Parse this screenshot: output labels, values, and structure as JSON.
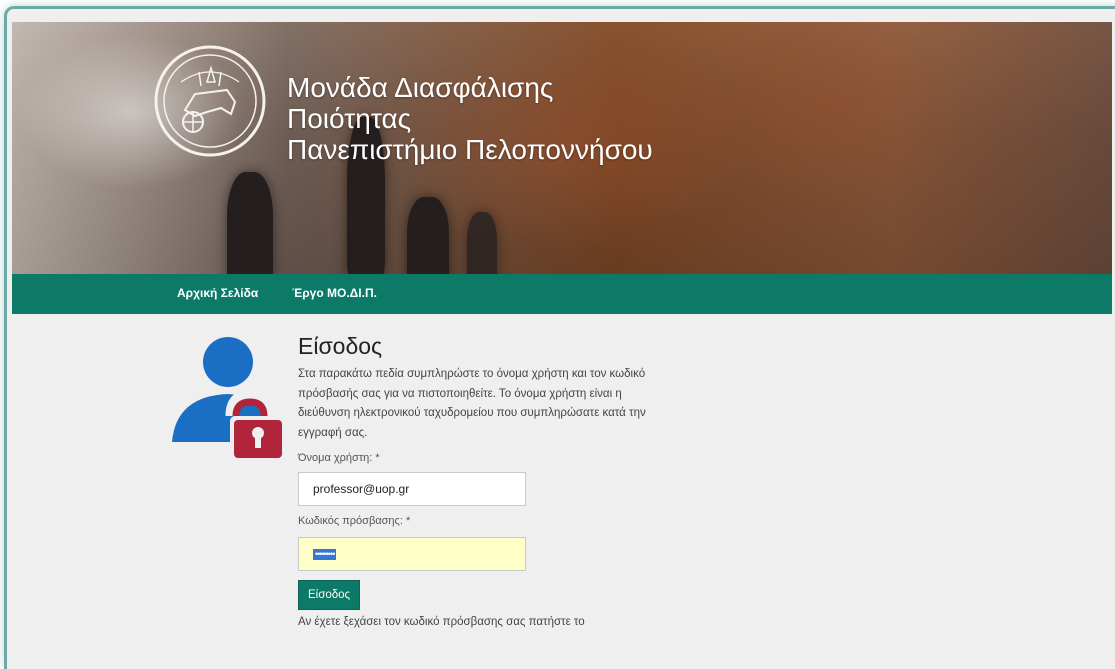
{
  "header": {
    "title_lines": [
      "Μονάδα Διασφάλισης",
      "Ποιότητας",
      "Πανεπιστήμιο Πελοποννήσου"
    ]
  },
  "nav": {
    "items": [
      {
        "label": "Αρχική Σελίδα"
      },
      {
        "label": "Έργο ΜΟ.ΔΙ.Π."
      }
    ]
  },
  "login": {
    "heading": "Είσοδος",
    "intro": "Στα παρακάτω πεδία συμπληρώστε το όνομα χρήστη και τον κωδικό πρόσβασής σας για να πιστοποιηθείτε. Το όνομα χρήστη είναι η διεύθυνση ηλεκτρονικού ταχυδρομείου που συμπληρώσατε κατά την εγγραφή σας.",
    "username_label": "Όνομα χρήστη: *",
    "username_value": "professor@uop.gr",
    "password_label": "Κωδικός πρόσβασης: *",
    "password_mask": "•••••••••",
    "submit_label": "Είσοδος",
    "forgot_text": "Αν έχετε ξεχάσει τον κωδικό πρόσβασης σας πατήστε το"
  },
  "colors": {
    "accent": "#0d7a68",
    "icon_person": "#1a6fc4",
    "icon_lock": "#b0243c",
    "password_bg": "#ffffc8"
  },
  "icons": {
    "seal": "university-seal-icon",
    "login": "user-lock-icon"
  }
}
